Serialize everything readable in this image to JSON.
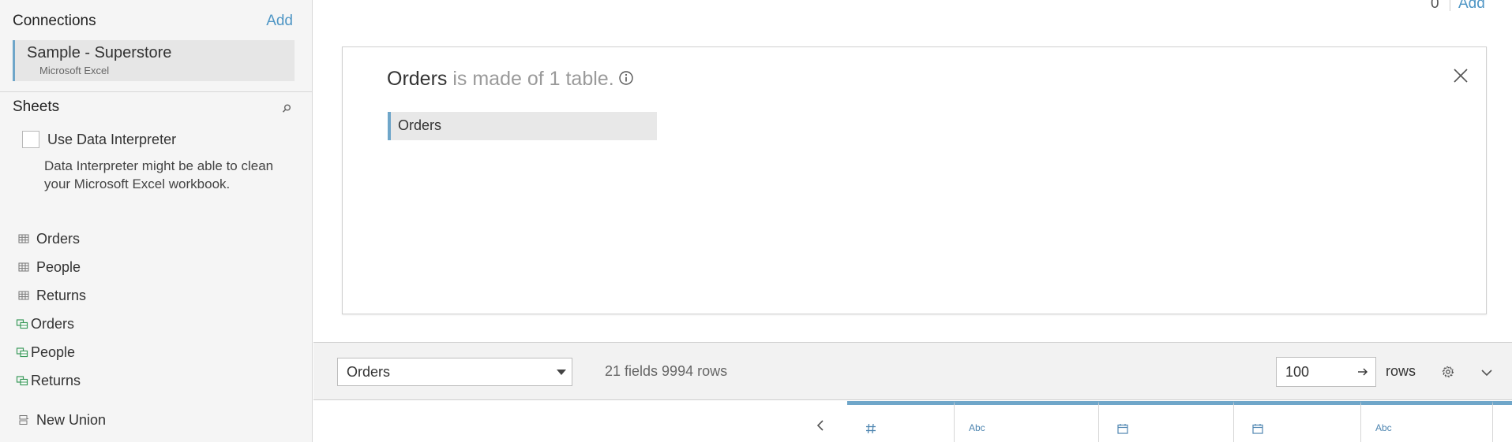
{
  "connections": {
    "title": "Connections",
    "add_label": "Add",
    "items": [
      {
        "name": "Sample - Superstore",
        "type": "Microsoft Excel"
      }
    ]
  },
  "sheets": {
    "title": "Sheets",
    "data_interpreter": {
      "label": "Use Data Interpreter",
      "checked": false,
      "description": "Data Interpreter might be able to clean your Microsoft Excel workbook."
    },
    "items": [
      {
        "label": "Orders",
        "kind": "sheet"
      },
      {
        "label": "People",
        "kind": "sheet"
      },
      {
        "label": "Returns",
        "kind": "sheet"
      },
      {
        "label": "Orders",
        "kind": "named-range"
      },
      {
        "label": "People",
        "kind": "named-range"
      },
      {
        "label": "Returns",
        "kind": "named-range"
      }
    ],
    "new_union": "New Union"
  },
  "topbar": {
    "filter_count": "0",
    "add_label": "Add"
  },
  "canvas": {
    "table_name": "Orders",
    "made_of_text": "is made of 1 table.",
    "tables": [
      "Orders"
    ]
  },
  "bottom_bar": {
    "table_select": "Orders",
    "fields_rows": "21 fields 9994 rows",
    "rows_value": "100",
    "rows_label": "rows"
  },
  "grid": {
    "columns": [
      {
        "type": "#"
      },
      {
        "type": "Abc"
      },
      {
        "type": "date"
      },
      {
        "type": "date"
      },
      {
        "type": "Abc"
      }
    ]
  },
  "colors": {
    "accent": "#4f96c5",
    "selection_bar": "#6fa6c9",
    "panel_bg": "#f5f5f5"
  }
}
